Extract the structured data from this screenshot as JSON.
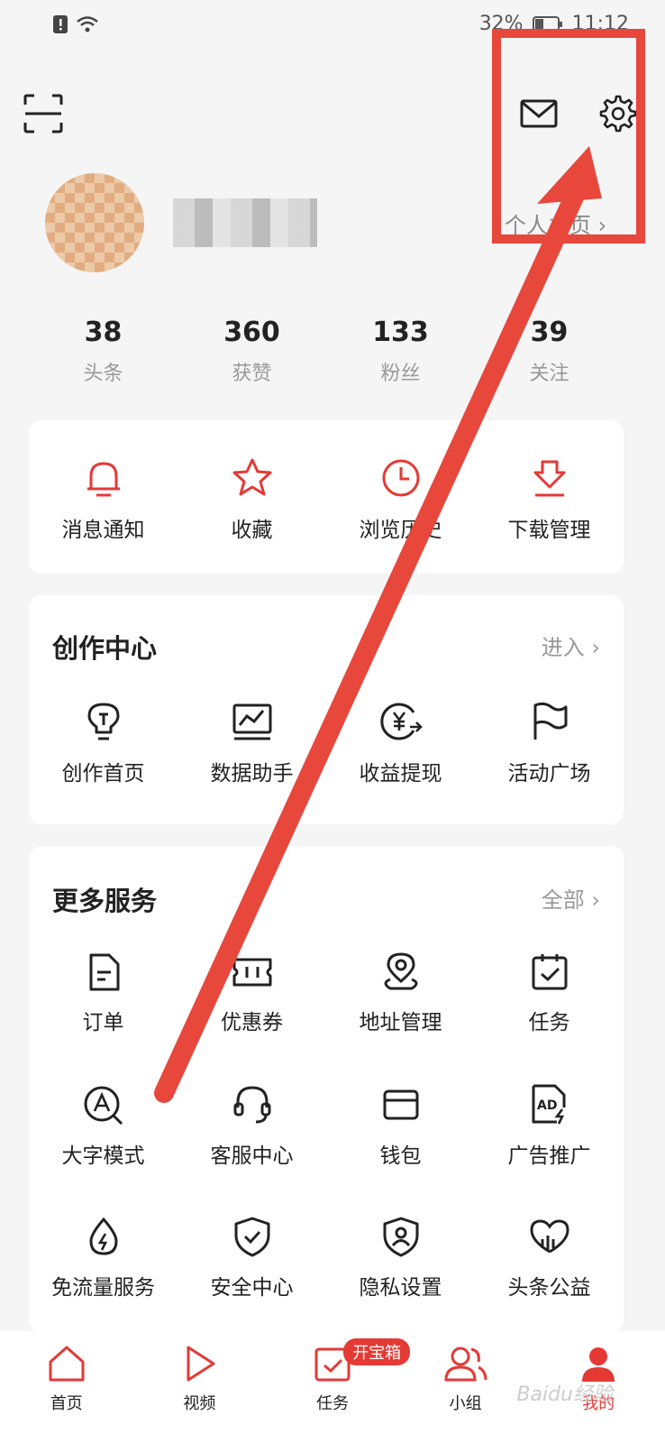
{
  "status_bar": {
    "battery": "32%",
    "time": "11:12"
  },
  "header": {
    "scan_icon": "scan-icon",
    "mail_icon": "mail-icon",
    "settings_icon": "gear-icon"
  },
  "profile": {
    "homepage_link": "个人主页 ›"
  },
  "stats": [
    {
      "value": "38",
      "label": "头条"
    },
    {
      "value": "360",
      "label": "获赞"
    },
    {
      "value": "133",
      "label": "粉丝"
    },
    {
      "value": "39",
      "label": "关注"
    }
  ],
  "quick_actions": [
    {
      "label": "消息通知",
      "icon": "bell-icon"
    },
    {
      "label": "收藏",
      "icon": "star-icon"
    },
    {
      "label": "浏览历史",
      "icon": "clock-icon"
    },
    {
      "label": "下载管理",
      "icon": "download-icon"
    }
  ],
  "creation_center": {
    "title": "创作中心",
    "more": "进入 ›",
    "items": [
      {
        "label": "创作首页",
        "icon": "lightbulb-icon"
      },
      {
        "label": "数据助手",
        "icon": "chart-icon"
      },
      {
        "label": "收益提现",
        "icon": "yuan-icon"
      },
      {
        "label": "活动广场",
        "icon": "flag-icon"
      }
    ]
  },
  "more_services": {
    "title": "更多服务",
    "more": "全部 ›",
    "rows": [
      [
        {
          "label": "订单",
          "icon": "document-icon"
        },
        {
          "label": "优惠券",
          "icon": "ticket-icon"
        },
        {
          "label": "地址管理",
          "icon": "location-icon"
        },
        {
          "label": "任务",
          "icon": "calendar-check-icon"
        }
      ],
      [
        {
          "label": "大字模式",
          "icon": "font-size-icon"
        },
        {
          "label": "客服中心",
          "icon": "headset-icon"
        },
        {
          "label": "钱包",
          "icon": "wallet-icon"
        },
        {
          "label": "广告推广",
          "icon": "ad-icon"
        }
      ],
      [
        {
          "label": "免流量服务",
          "icon": "data-drop-icon"
        },
        {
          "label": "安全中心",
          "icon": "shield-icon"
        },
        {
          "label": "隐私设置",
          "icon": "privacy-icon"
        },
        {
          "label": "头条公益",
          "icon": "charity-icon"
        }
      ]
    ]
  },
  "bottom_nav": [
    {
      "label": "首页",
      "icon": "home-icon"
    },
    {
      "label": "视频",
      "icon": "play-icon"
    },
    {
      "label": "任务",
      "icon": "task-icon",
      "badge": "开宝箱"
    },
    {
      "label": "小组",
      "icon": "group-icon"
    },
    {
      "label": "我的",
      "icon": "profile-icon",
      "active": true
    }
  ],
  "watermark": "Baidu经验",
  "colors": {
    "accent": "#e53935",
    "annotation": "#e8473c",
    "background": "#f5f5f5"
  }
}
